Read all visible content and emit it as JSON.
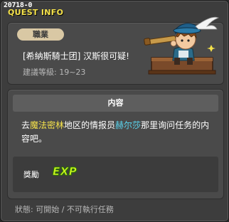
{
  "window": {
    "quest_id": "20718-0",
    "title": "QUEST INFO"
  },
  "header": {
    "job_badge": "職業",
    "quest_name": "[希納斯騎士团] 汉斯很可疑!",
    "recommended_level": "建議等級: 19~23",
    "npc_image": "npc-knight-with-telescope"
  },
  "content": {
    "header_label": "内容",
    "text_parts": {
      "p1": "去",
      "hl1": "魔法密林",
      "p2": "地区的情报员",
      "hl2": "赫尔莎",
      "p3": "那里询问任务的内容吧。"
    },
    "reward_label": "獎勵",
    "reward_icon": "exp-icon",
    "reward_icon_text": "EXP"
  },
  "status": {
    "text": "狀態: 可開始 / 不可執行任務"
  },
  "colors": {
    "title": "#f5e24a",
    "highlight_place": "#f5e24a",
    "highlight_npc": "#5ad6f0",
    "exp": "#c7f51a"
  }
}
